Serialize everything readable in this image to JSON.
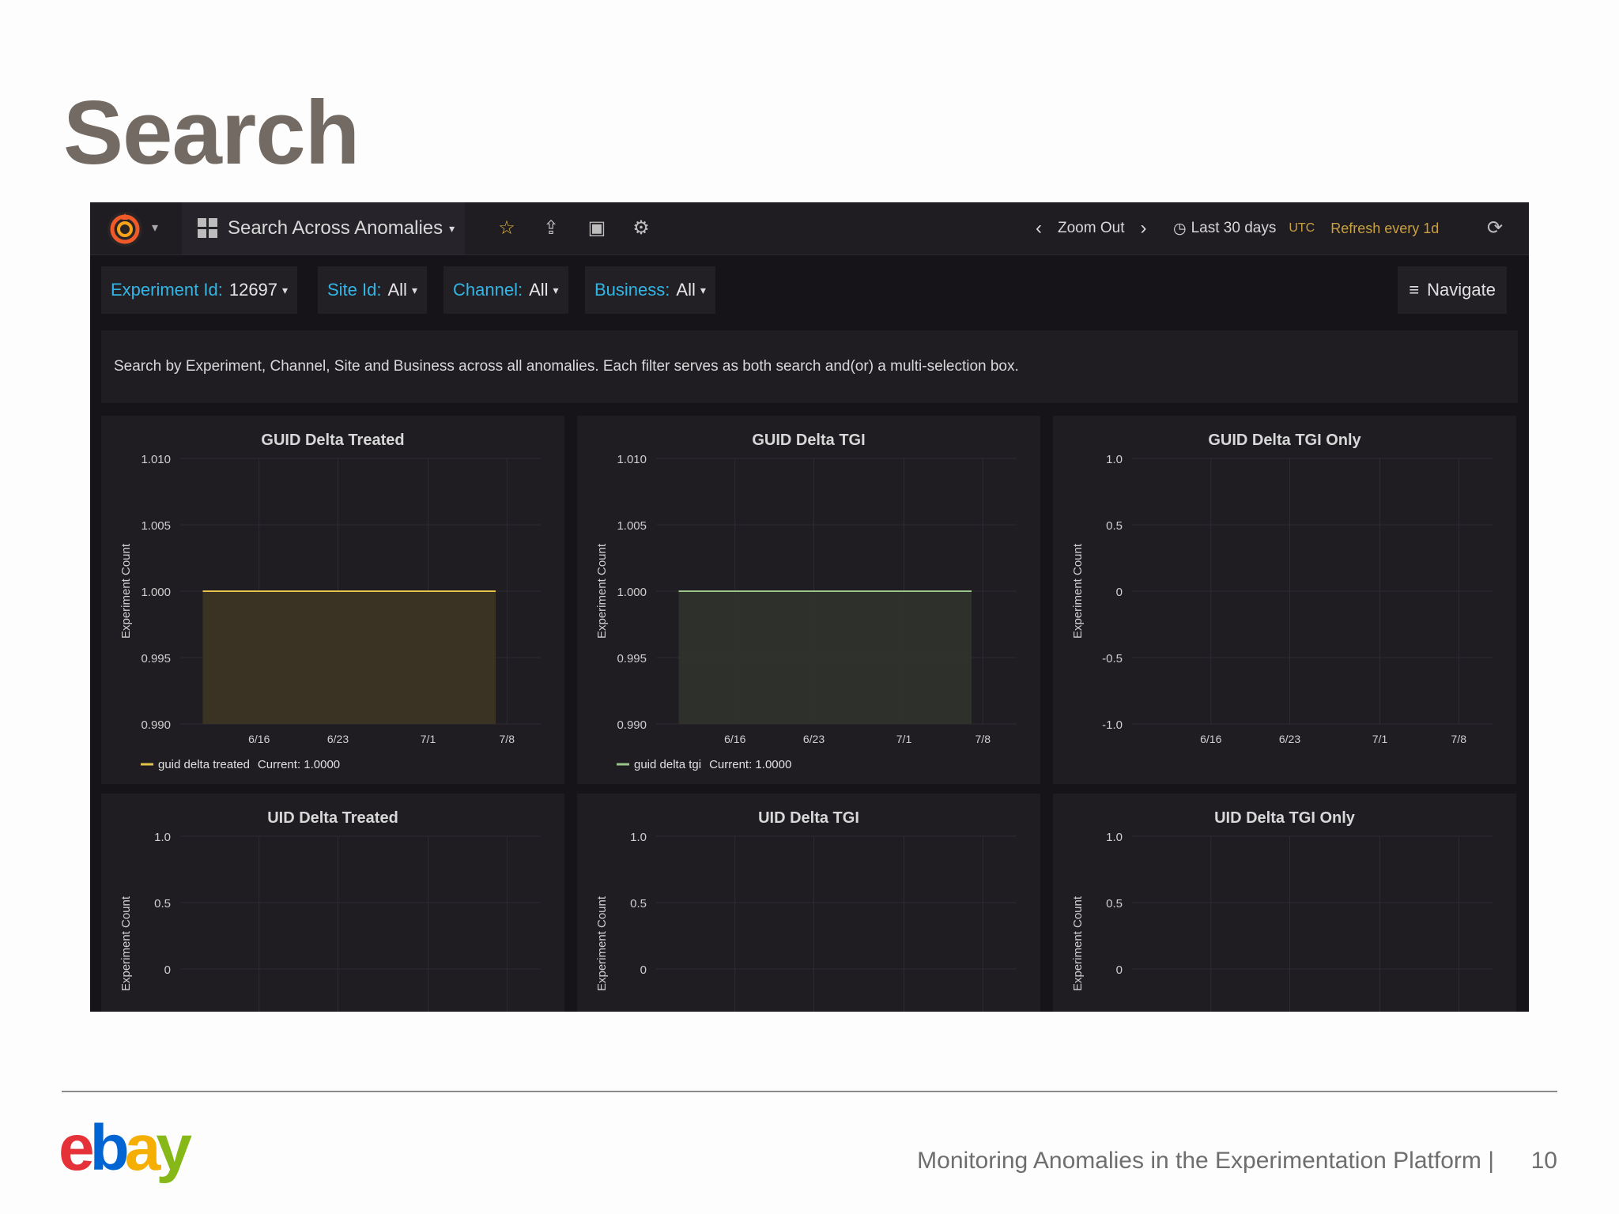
{
  "slide": {
    "title": "Search",
    "footer_text": "Monitoring Anomalies in the Experimentation Platform  |",
    "page_number": "10",
    "logo_text": "ebay"
  },
  "topbar": {
    "dashboard_title": "Search Across Anomalies",
    "zoom_out": "Zoom Out",
    "time_range": "Last 30 days",
    "timezone": "UTC",
    "refresh": "Refresh every 1d"
  },
  "filters": [
    {
      "label": "Experiment Id:",
      "value": "12697"
    },
    {
      "label": "Site Id:",
      "value": "All"
    },
    {
      "label": "Channel:",
      "value": "All"
    },
    {
      "label": "Business:",
      "value": "All"
    }
  ],
  "navigate_label": "Navigate",
  "description": "Search by Experiment, Channel, Site and Business across all anomalies. Each filter serves as both search and(or) a multi-selection box.",
  "colors": {
    "accent_blue": "#33b5e5",
    "series_yellow": "#e5c24a",
    "series_green": "#9ac48a",
    "refresh_orange": "#c8a040"
  },
  "icons": [
    "grafana-logo-icon",
    "dashboard-grid-icon",
    "star-icon",
    "share-icon",
    "save-icon",
    "gear-icon",
    "chevron-left-icon",
    "chevron-right-icon",
    "clock-icon",
    "refresh-icon",
    "menu-icon"
  ],
  "chart_data": [
    {
      "type": "area",
      "title": "GUID Delta Treated",
      "ylabel": "Experiment Count",
      "yticks": [
        "1.010",
        "1.005",
        "1.000",
        "0.995",
        "0.990"
      ],
      "ylim": [
        0.99,
        1.01
      ],
      "xticks": [
        "6/16",
        "6/23",
        "7/1",
        "7/8"
      ],
      "series": [
        {
          "name": "guid delta treated",
          "x": [
            "6/11",
            "7/7"
          ],
          "values": [
            1.0,
            1.0
          ],
          "color": "#e5c24a"
        }
      ],
      "legend": {
        "name": "guid delta treated",
        "current_label": "Current: 1.0000"
      }
    },
    {
      "type": "area",
      "title": "GUID Delta TGI",
      "ylabel": "Experiment Count",
      "yticks": [
        "1.010",
        "1.005",
        "1.000",
        "0.995",
        "0.990"
      ],
      "ylim": [
        0.99,
        1.01
      ],
      "xticks": [
        "6/16",
        "6/23",
        "7/1",
        "7/8"
      ],
      "series": [
        {
          "name": "guid delta tgi",
          "x": [
            "6/11",
            "7/7"
          ],
          "values": [
            1.0,
            1.0
          ],
          "color": "#9ac48a"
        }
      ],
      "legend": {
        "name": "guid delta tgi",
        "current_label": "Current: 1.0000"
      }
    },
    {
      "type": "line",
      "title": "GUID Delta TGI Only",
      "ylabel": "Experiment Count",
      "yticks": [
        "1.0",
        "0.5",
        "0",
        "-0.5",
        "-1.0"
      ],
      "ylim": [
        -1.0,
        1.0
      ],
      "xticks": [
        "6/16",
        "6/23",
        "7/1",
        "7/8"
      ],
      "series": []
    },
    {
      "type": "line",
      "title": "UID Delta Treated",
      "ylabel": "Experiment Count",
      "yticks": [
        "1.0",
        "0.5",
        "0"
      ],
      "ylim": [
        -1.0,
        1.0
      ],
      "xticks": [],
      "series": []
    },
    {
      "type": "line",
      "title": "UID Delta TGI",
      "ylabel": "Experiment Count",
      "yticks": [
        "1.0",
        "0.5",
        "0"
      ],
      "ylim": [
        -1.0,
        1.0
      ],
      "xticks": [],
      "series": []
    },
    {
      "type": "line",
      "title": "UID Delta TGI Only",
      "ylabel": "Experiment Count",
      "yticks": [
        "1.0",
        "0.5",
        "0"
      ],
      "ylim": [
        -1.0,
        1.0
      ],
      "xticks": [],
      "series": []
    }
  ]
}
